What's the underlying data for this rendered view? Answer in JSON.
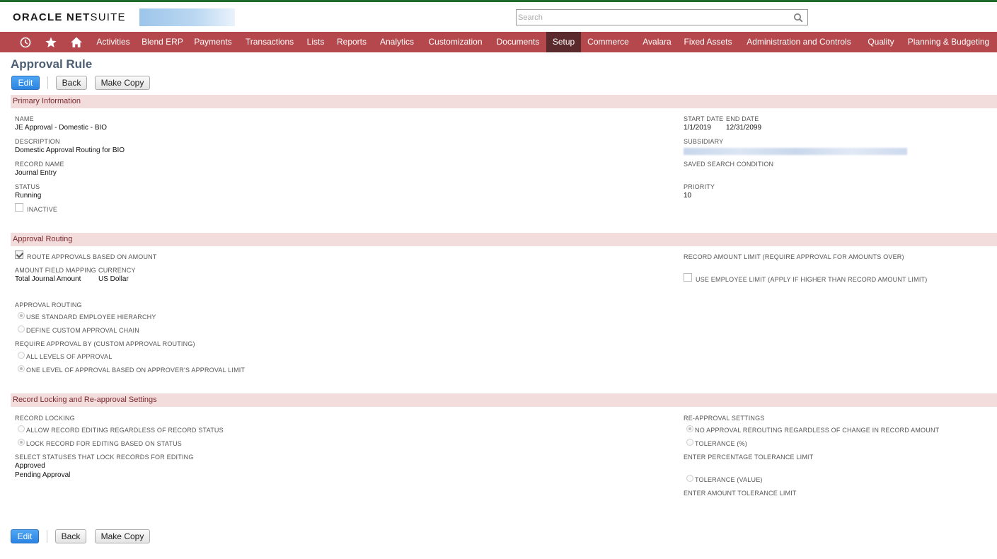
{
  "header": {
    "logo_oracle": "ORACLE",
    "logo_net": "NET",
    "logo_suite": "SUITE",
    "search_placeholder": "Search",
    "icons": [
      "history-icon",
      "star-icon",
      "home-icon",
      "search-icon"
    ]
  },
  "nav": {
    "items": [
      {
        "label": "Activities"
      },
      {
        "label": "Blend ERP"
      },
      {
        "label": "Payments"
      },
      {
        "label": "Transactions"
      },
      {
        "label": "Lists"
      },
      {
        "label": "Reports"
      },
      {
        "label": "Analytics"
      },
      {
        "label": "Customization"
      },
      {
        "label": "Documents"
      },
      {
        "label": "Setup"
      },
      {
        "label": "Commerce"
      },
      {
        "label": "Avalara"
      },
      {
        "label": "Fixed Assets"
      },
      {
        "label": "Administration and Controls"
      },
      {
        "label": "Quality"
      },
      {
        "label": "Planning & Budgeting"
      }
    ],
    "active": "Setup"
  },
  "page": {
    "title": "Approval Rule"
  },
  "buttons": {
    "edit": "Edit",
    "back": "Back",
    "make_copy": "Make Copy"
  },
  "primary": {
    "section_title": "Primary Information",
    "name_label": "NAME",
    "name_value": "JE Approval - Domestic - BIO",
    "description_label": "DESCRIPTION",
    "description_value": "Domestic Approval Routing for BIO",
    "record_name_label": "RECORD NAME",
    "record_name_value": "Journal Entry",
    "status_label": "STATUS",
    "status_value": "Running",
    "inactive_label": "INACTIVE",
    "start_date_label": "START DATE",
    "start_date_value": "1/1/2019",
    "end_date_label": "END DATE",
    "end_date_value": "12/31/2099",
    "subsidiary_label": "SUBSIDIARY",
    "saved_search_label": "SAVED SEARCH CONDITION",
    "priority_label": "PRIORITY",
    "priority_value": "10"
  },
  "routing": {
    "section_title": "Approval Routing",
    "route_by_amount_label": "ROUTE APPROVALS BASED ON AMOUNT",
    "amount_field_label": "AMOUNT FIELD MAPPING",
    "amount_field_value": "Total Journal Amount",
    "currency_label": "CURRENCY",
    "currency_value": "US Dollar",
    "record_amount_limit_label": "RECORD AMOUNT LIMIT (REQUIRE APPROVAL FOR AMOUNTS OVER)",
    "use_employee_limit_label": "USE EMPLOYEE LIMIT (APPLY IF HIGHER THAN RECORD AMOUNT LIMIT)",
    "approval_routing_label": "APPROVAL ROUTING",
    "opt_standard": "USE STANDARD EMPLOYEE HIERARCHY",
    "opt_custom": "DEFINE CUSTOM APPROVAL CHAIN",
    "require_by_label": "REQUIRE APPROVAL BY (CUSTOM APPROVAL ROUTING)",
    "opt_all_levels": "ALL LEVELS OF APPROVAL",
    "opt_one_level": "ONE LEVEL OF APPROVAL BASED ON APPROVER'S APPROVAL LIMIT"
  },
  "locking": {
    "section_title": "Record Locking and Re-approval Settings",
    "record_locking_label": "RECORD LOCKING",
    "opt_allow_editing": "ALLOW RECORD EDITING REGARDLESS OF RECORD STATUS",
    "opt_lock_status": "LOCK RECORD FOR EDITING BASED ON STATUS",
    "statuses_label": "SELECT STATUSES THAT LOCK RECORDS FOR EDITING",
    "status_approved": "Approved",
    "status_pending": "Pending Approval",
    "reapproval_label": "RE-APPROVAL SETTINGS",
    "opt_no_rerouting": "NO APPROVAL REROUTING REGARDLESS OF CHANGE IN RECORD AMOUNT",
    "opt_tolerance_pct": "TOLERANCE (%)",
    "pct_limit_label": "ENTER PERCENTAGE TOLERANCE LIMIT",
    "opt_tolerance_val": "TOLERANCE (VALUE)",
    "amount_limit_label": "ENTER AMOUNT TOLERANCE LIMIT"
  }
}
